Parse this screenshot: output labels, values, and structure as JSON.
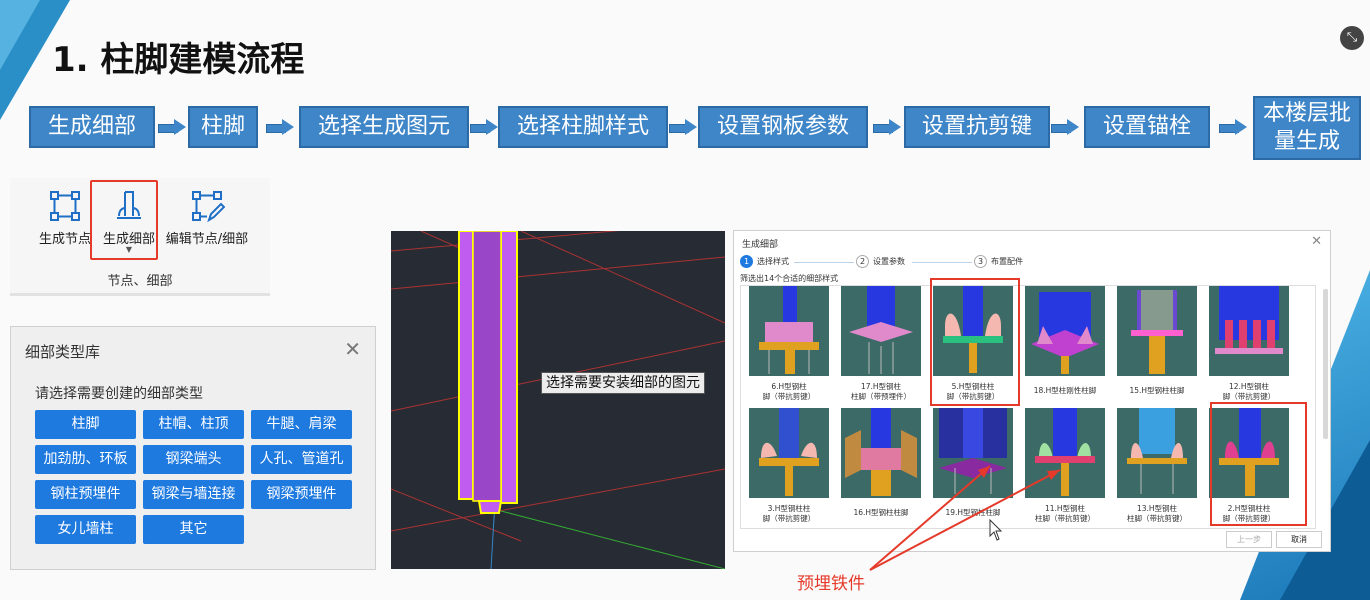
{
  "title": "1. 柱脚建模流程",
  "exit_icon": "exit-fullscreen-icon",
  "flow": {
    "steps": [
      "生成细部",
      "柱脚",
      "选择生成图元",
      "选择柱脚样式",
      "设置钢板参数",
      "设置抗剪键",
      "设置锚栓",
      "本楼层批",
      "量生成"
    ]
  },
  "ribbon": {
    "buttons": [
      "生成节点",
      "生成细部",
      "编辑节点/细部"
    ],
    "group": "节点、细部"
  },
  "library": {
    "title": "细部类型库",
    "subtitle": "请选择需要创建的细部类型",
    "buttons": [
      "柱脚",
      "柱帽、柱顶",
      "牛腿、肩梁",
      "加劲肋、环板",
      "钢梁端头",
      "人孔、管道孔",
      "钢柱预埋件",
      "钢梁与墙连接",
      "钢梁预埋件",
      "女儿墙柱",
      "其它"
    ]
  },
  "cad": {
    "tooltip": "选择需要安装细部的图元"
  },
  "dialog": {
    "title": "生成细部",
    "wizard": [
      {
        "num": "1",
        "label": "选择样式"
      },
      {
        "num": "2",
        "label": "设置参数"
      },
      {
        "num": "3",
        "label": "布置配件"
      }
    ],
    "filter": "筛选出14个合适的细部样式",
    "row1": [
      {
        "l1": "6.H型钢柱",
        "l2": "脚（带抗剪键）"
      },
      {
        "l1": "17.H型钢柱",
        "l2": "柱脚（带预埋件）"
      },
      {
        "l1": "5.H型钢柱柱",
        "l2": "脚（带抗剪键）"
      },
      {
        "l1": "18.H型柱刚性柱脚",
        "l2": ""
      },
      {
        "l1": "15.H型钢柱柱脚",
        "l2": ""
      },
      {
        "l1": "12.H型钢柱",
        "l2": "脚（带抗剪键）"
      }
    ],
    "row2": [
      {
        "l1": "3.H型钢柱柱",
        "l2": "脚（带抗剪键）"
      },
      {
        "l1": "16.H型钢柱柱脚",
        "l2": ""
      },
      {
        "l1": "19.H型钢柱柱脚",
        "l2": ""
      },
      {
        "l1": "11.H型钢柱",
        "l2": "柱脚（带抗剪键）"
      },
      {
        "l1": "13.H型钢柱",
        "l2": "柱脚（带抗剪键）"
      },
      {
        "l1": "2.H型钢柱柱",
        "l2": "脚（带抗剪键）"
      }
    ],
    "prev": "上一步",
    "cancel": "取消"
  },
  "annotation": "预埋铁件"
}
